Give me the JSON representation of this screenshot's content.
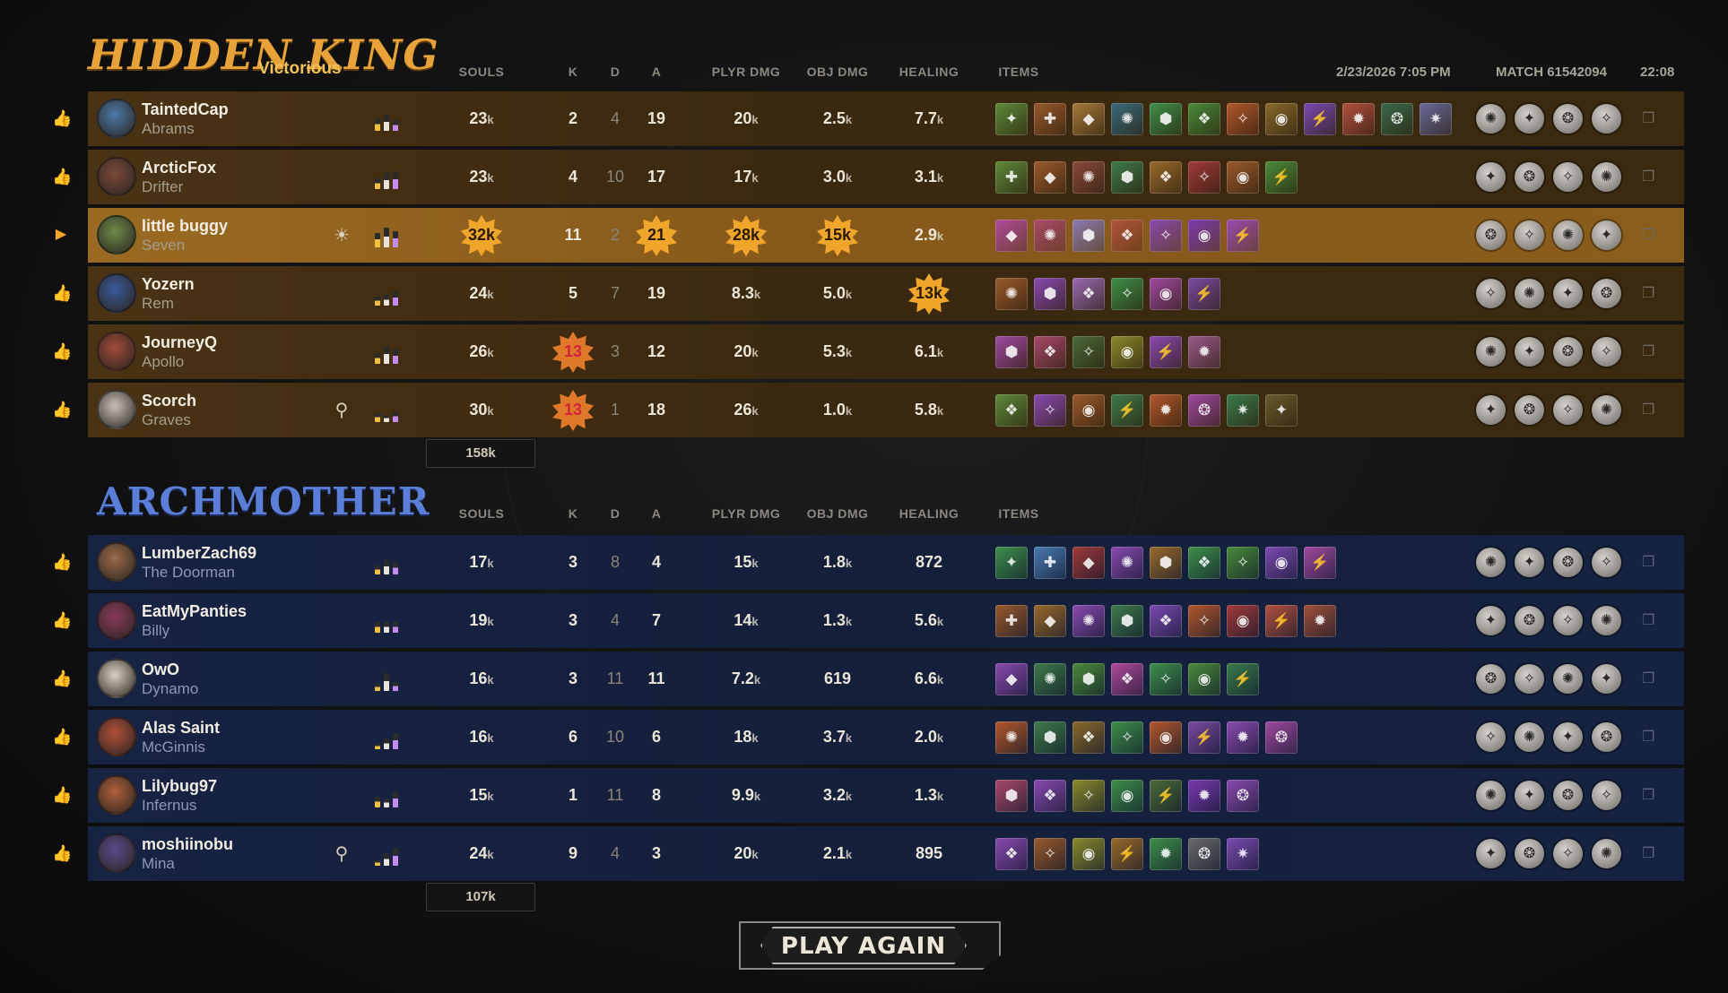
{
  "match": {
    "date": "2/23/2026 7:05 PM",
    "id_label": "MATCH 61542094",
    "duration": "22:08",
    "play_again": "PLAY AGAIN"
  },
  "columns": {
    "souls": "SOULS",
    "k": "K",
    "d": "D",
    "a": "A",
    "plyr_dmg": "PLYR DMG",
    "obj_dmg": "OBJ DMG",
    "healing": "HEALING",
    "items": "ITEMS"
  },
  "team1": {
    "name": "HIDDEN KING",
    "result": "Victorious",
    "total_souls": "158k",
    "accent": "#e7a23a",
    "players": [
      {
        "player": "TaintedCap",
        "hero": "Abrams",
        "souls": "23",
        "k": "2",
        "d": "4",
        "a": "19",
        "plyr": "20",
        "obj": "2.5",
        "heal": "7.7",
        "avatar_color": "#4d78a6",
        "items": [
          "#5e8a3a",
          "#9a5a2c",
          "#a57a3a",
          "#3b6a7a",
          "#3f8f4a",
          "#4a8a3a",
          "#b2582c",
          "#8a6a2c",
          "#7a4ab0",
          "#b25040",
          "#3a6a4a",
          "#6a6a9a"
        ],
        "abilities": [
          "swirl-icon",
          "beast-icon",
          "mask-icon",
          "claw-icon"
        ],
        "bars": [
          14,
          18,
          12
        ]
      },
      {
        "player": "ArcticFox",
        "hero": "Drifter",
        "souls": "23",
        "k": "4",
        "d": "10",
        "a": "17",
        "plyr": "17",
        "obj": "3.0",
        "heal": "3.1",
        "avatar_color": "#7a4a3a",
        "items": [
          "#5e8a3a",
          "#9a5a2c",
          "#8a4a3a",
          "#3f7a4a",
          "#9a6a2c",
          "#a03a3a",
          "#9a5a2c",
          "#4a8a3a"
        ],
        "abilities": [
          "cross-icon",
          "fang-icon",
          "bite-icon",
          "wolf-icon"
        ],
        "bars": [
          12,
          18,
          20
        ]
      },
      {
        "player": "little buggy",
        "hero": "Seven",
        "souls": "32",
        "k": "11",
        "d": "2",
        "a": "21",
        "plyr": "28",
        "obj": "15",
        "heal": "2.9",
        "avatar_color": "#6f8a4a",
        "items": [
          "#b04a9a",
          "#a84a6a",
          "#8a7ab0",
          "#b0543a",
          "#8a4ab0",
          "#7a3ab0",
          "#9a4ab0"
        ],
        "abilities": [
          "orb-icon",
          "spark-icon",
          "bolt-icon",
          "storm-icon"
        ],
        "bars": [
          16,
          22,
          18
        ],
        "me": true
      },
      {
        "player": "Yozern",
        "hero": "Rem",
        "souls": "24",
        "k": "5",
        "d": "7",
        "a": "19",
        "plyr": "8.3",
        "obj": "5.0",
        "heal": "13",
        "avatar_color": "#3a5a9a",
        "items": [
          "#9a5a2c",
          "#8a4ab0",
          "#9a6ab0",
          "#3f8f4a",
          "#a04aa0",
          "#7a4aa0"
        ],
        "abilities": [
          "lamp-icon",
          "sheep-icon",
          "pillow-icon",
          "moon-icon"
        ],
        "bars": [
          10,
          12,
          16
        ]
      },
      {
        "player": "JourneyQ",
        "hero": "Apollo",
        "souls": "26",
        "k": "13",
        "d": "3",
        "a": "12",
        "plyr": "20",
        "obj": "5.3",
        "heal": "6.1",
        "avatar_color": "#a04a3a",
        "items": [
          "#a04aa0",
          "#a84a6a",
          "#4a6a3a",
          "#8a8a2c",
          "#8a4ab0",
          "#9a5a8a"
        ],
        "abilities": [
          "sun-icon",
          "blade-icon",
          "wing-icon",
          "shield-icon"
        ],
        "bars": [
          12,
          20,
          16
        ]
      },
      {
        "player": "Scorch",
        "hero": "Graves",
        "souls": "30",
        "k": "13",
        "d": "1",
        "a": "18",
        "plyr": "26",
        "obj": "1.0",
        "heal": "5.8",
        "avatar_color": "#c8c0b8",
        "items": [
          "#5e8a3a",
          "#8a4ab0",
          "#9a5a2c",
          "#3f7a4a",
          "#b2582c",
          "#a04aa0",
          "#3a7a4a",
          "#6a5a2c"
        ],
        "abilities": [
          "skull-icon",
          "hand-icon",
          "ghost-icon",
          "grave-icon"
        ],
        "bars": [
          10,
          8,
          12
        ]
      }
    ]
  },
  "team2": {
    "name": "ARCHMOTHER",
    "total_souls": "107k",
    "accent": "#5b7fd8",
    "players": [
      {
        "player": "LumberZach69",
        "hero": "The Doorman",
        "souls": "17",
        "k": "3",
        "d": "8",
        "a": "4",
        "plyr": "15",
        "obj": "1.8",
        "heal": "872",
        "avatar_color": "#9a6a4a",
        "items": [
          "#3f8f4a",
          "#4a7ab0",
          "#a03a3a",
          "#8a4ab0",
          "#9a6a2c",
          "#3f8f4a",
          "#4a8a3a",
          "#7a4ab0",
          "#a04aa0"
        ],
        "abilities": [
          "door-icon",
          "bag-icon",
          "bell-icon",
          "cart-icon"
        ],
        "bars": [
          10,
          16,
          14
        ]
      },
      {
        "player": "EatMyPanties",
        "hero": "Billy",
        "souls": "19",
        "k": "3",
        "d": "4",
        "a": "7",
        "plyr": "14",
        "obj": "1.3",
        "heal": "5.6",
        "avatar_color": "#8a3a5a",
        "items": [
          "#9a5a2c",
          "#9a6a2c",
          "#8a4ab0",
          "#3f7a4a",
          "#7a4ab0",
          "#b2582c",
          "#a03a3a",
          "#b25040",
          "#a0503a"
        ],
        "abilities": [
          "chain-icon",
          "fist-icon",
          "bash-icon",
          "spin-icon"
        ],
        "bars": [
          12,
          12,
          12
        ]
      },
      {
        "player": "OwO",
        "hero": "Dynamo",
        "souls": "16",
        "k": "3",
        "d": "11",
        "a": "11",
        "plyr": "7.2",
        "obj": "619",
        "heal": "6.6",
        "avatar_color": "#d8d0c0",
        "items": [
          "#8a4ab0",
          "#3f7a4a",
          "#4a8a3a",
          "#b04a9a",
          "#3f8f4a",
          "#4a8a3a",
          "#3a7a4a"
        ],
        "abilities": [
          "portal-icon",
          "pull-icon",
          "orbit-icon",
          "rift-icon"
        ],
        "bars": [
          8,
          20,
          10
        ]
      },
      {
        "player": "Alas Saint",
        "hero": "McGinnis",
        "souls": "16",
        "k": "6",
        "d": "10",
        "a": "6",
        "plyr": "18",
        "obj": "3.7",
        "heal": "2.0",
        "avatar_color": "#b0503a",
        "items": [
          "#b2582c",
          "#3f7a4a",
          "#8a6a2c",
          "#3f8f4a",
          "#b2582c",
          "#7a4aa0",
          "#8a4ab0",
          "#a04aa0"
        ],
        "abilities": [
          "turret-icon",
          "wrench-icon",
          "wall-icon",
          "barrage-icon"
        ],
        "bars": [
          6,
          12,
          18
        ]
      },
      {
        "player": "Lilybug97",
        "hero": "Infernus",
        "souls": "15",
        "k": "1",
        "d": "11",
        "a": "8",
        "plyr": "9.9",
        "obj": "3.2",
        "heal": "1.3",
        "avatar_color": "#b0603a",
        "items": [
          "#a84a6a",
          "#8a4ab0",
          "#8a8a2c",
          "#3f8f4a",
          "#4a6a3a",
          "#7a3ab0",
          "#8a4ab0"
        ],
        "abilities": [
          "fuel-icon",
          "dash-icon",
          "flame-icon",
          "nova-icon"
        ],
        "bars": [
          12,
          10,
          18
        ]
      },
      {
        "player": "moshiinobu",
        "hero": "Mina",
        "souls": "24",
        "k": "9",
        "d": "4",
        "a": "3",
        "plyr": "20",
        "obj": "2.1",
        "heal": "895",
        "avatar_color": "#5a4a8a",
        "items": [
          "#8a4ab0",
          "#9a5a2c",
          "#8a8a2c",
          "#9a6a2c",
          "#3f8f4a",
          "#6a6a6a",
          "#7a4ab0"
        ],
        "abilities": [
          "bat-icon",
          "wings-icon",
          "fangs-icon",
          "blood-icon"
        ],
        "bars": [
          6,
          14,
          20
        ]
      }
    ]
  }
}
